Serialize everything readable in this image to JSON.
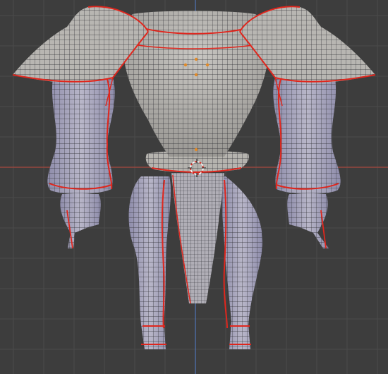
{
  "viewport": {
    "background": "#3d3d3d",
    "grid_color": "#4a4a4a",
    "x_axis_color": "#a8483f",
    "y_axis_color": "#4f75b8"
  },
  "model": {
    "surface_color": "#a8a6a4",
    "shadow_surface_color": "#8c8aa8",
    "wire_color": "#2e2e34",
    "seam_color": "#e0261d",
    "vertex_color": "#e08a2a"
  },
  "cursor": {
    "name": "3d-cursor",
    "colors": [
      "#e0261d",
      "#ffffff"
    ]
  }
}
